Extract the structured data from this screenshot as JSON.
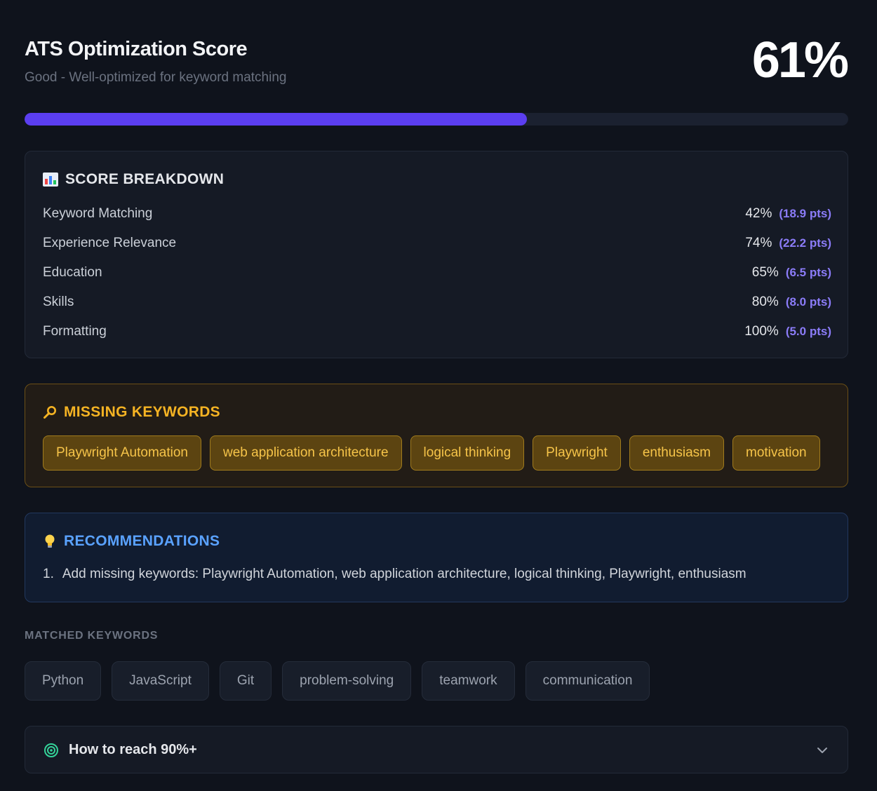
{
  "header": {
    "title": "ATS Optimization Score",
    "subtitle": "Good - Well-optimized for keyword matching",
    "score": "61%",
    "progress_fraction": 0.61,
    "accent_color": "#5b3ef0"
  },
  "breakdown": {
    "icon": "bar-chart-icon",
    "title": "SCORE BREAKDOWN",
    "rows": [
      {
        "label": "Keyword Matching",
        "percent": "42%",
        "points": "(18.9 pts)"
      },
      {
        "label": "Experience Relevance",
        "percent": "74%",
        "points": "(22.2 pts)"
      },
      {
        "label": "Education",
        "percent": "65%",
        "points": "(6.5 pts)"
      },
      {
        "label": "Skills",
        "percent": "80%",
        "points": "(8.0 pts)"
      },
      {
        "label": "Formatting",
        "percent": "100%",
        "points": "(5.0 pts)"
      }
    ]
  },
  "missing": {
    "icon": "magnifier-icon",
    "title": "MISSING KEYWORDS",
    "color": "#f5b323",
    "keywords": [
      "Playwright Automation",
      "web application architecture",
      "logical thinking",
      "Playwright",
      "enthusiasm",
      "motivation"
    ]
  },
  "recommendations": {
    "icon": "lightbulb-icon",
    "title": "RECOMMENDATIONS",
    "color": "#5aa2ff",
    "items": [
      {
        "num": "1.",
        "text": "Add missing keywords: Playwright Automation, web application architecture, logical thinking, Playwright, enthusiasm"
      }
    ]
  },
  "matched": {
    "label": "MATCHED KEYWORDS",
    "keywords": [
      "Python",
      "JavaScript",
      "Git",
      "problem-solving",
      "teamwork",
      "communication"
    ]
  },
  "reach": {
    "icon": "target-icon",
    "title": "How to reach 90%+",
    "toggle_icon": "chevron-down-icon"
  }
}
